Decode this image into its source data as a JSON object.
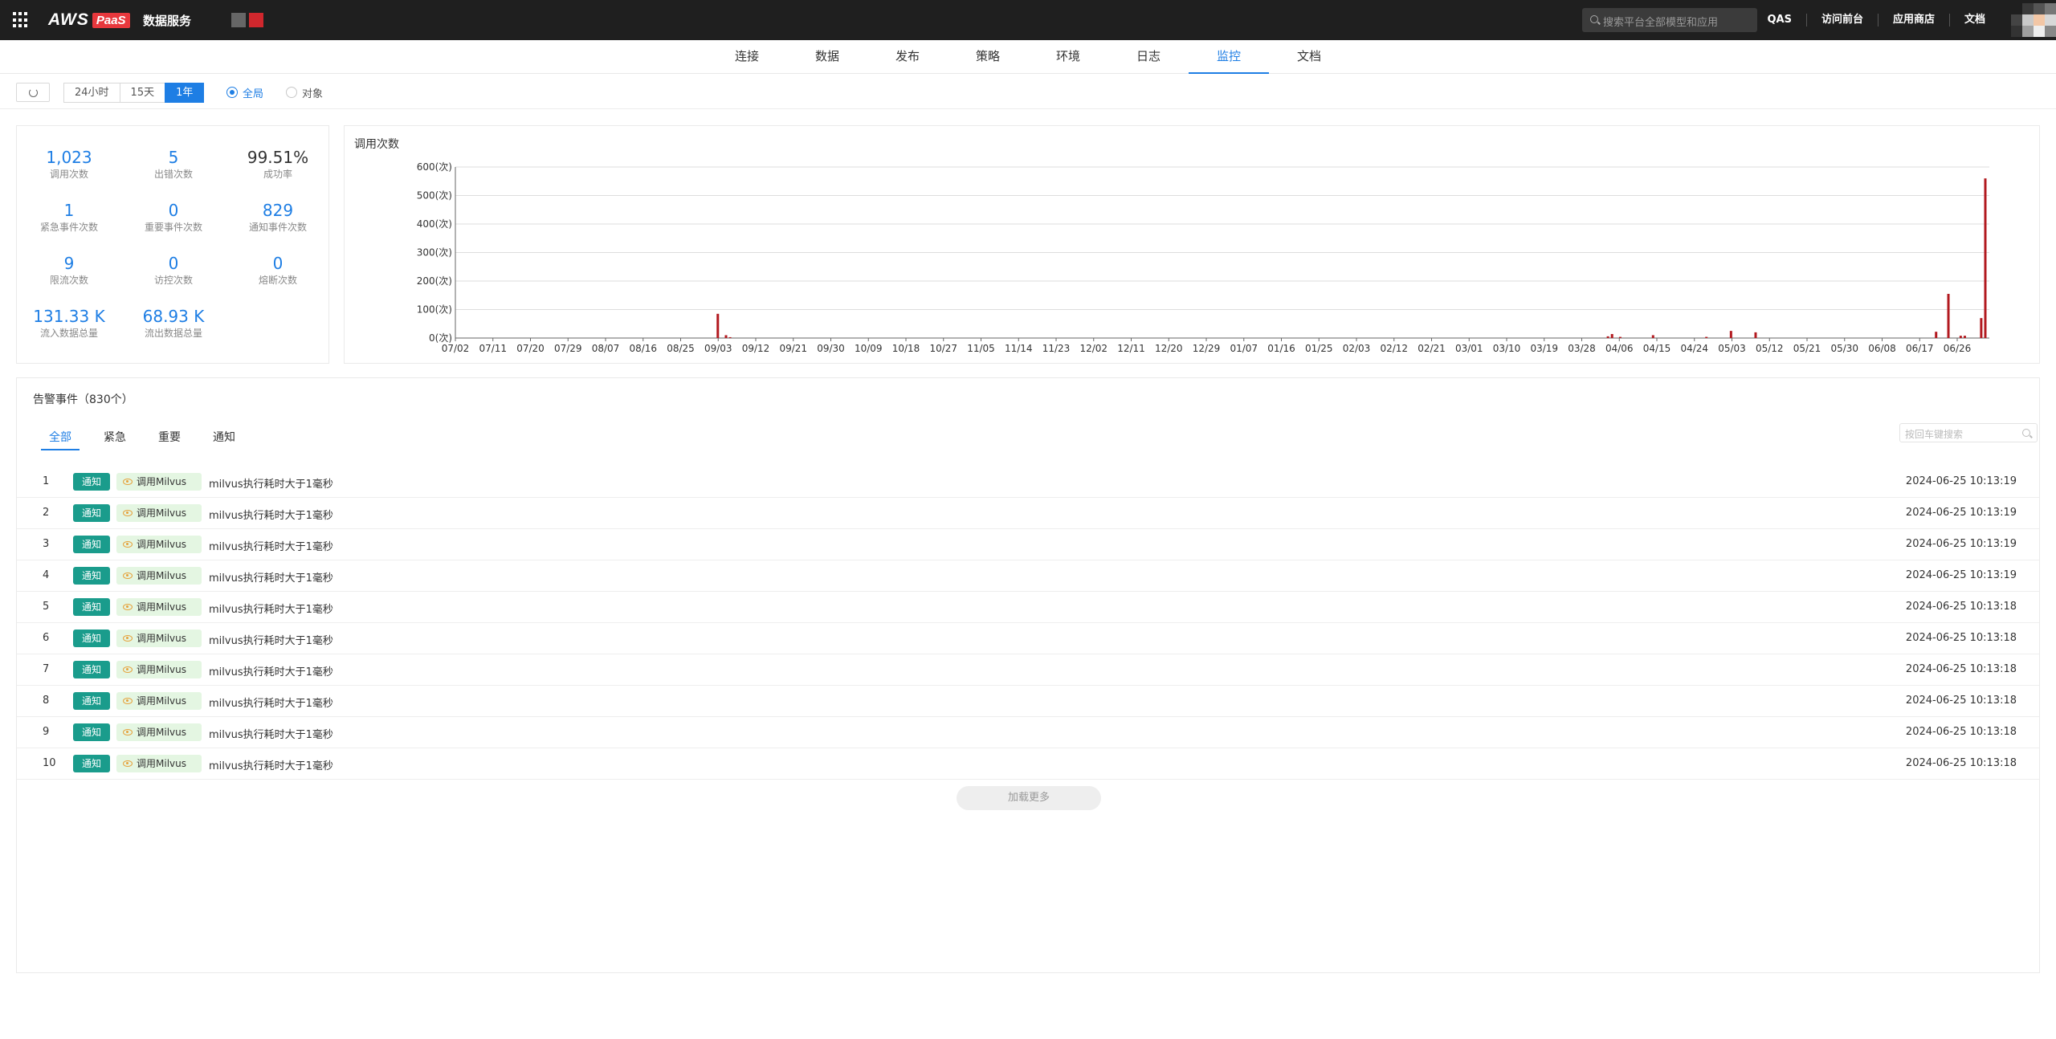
{
  "header": {
    "logo_aws": "AWS",
    "logo_paas": "PaaS",
    "app_name": "数据服务",
    "search_placeholder": "搜索平台全部模型和应用",
    "links": [
      "QAS",
      "访问前台",
      "应用商店",
      "文档"
    ]
  },
  "nav": {
    "tabs": [
      "连接",
      "数据",
      "发布",
      "策略",
      "环境",
      "日志",
      "监控",
      "文档"
    ],
    "active": "监控"
  },
  "toolbar": {
    "ranges": [
      "24小时",
      "15天",
      "1年"
    ],
    "active_range": "1年",
    "scope": [
      "全局",
      "对象"
    ],
    "active_scope": "全局"
  },
  "stats": [
    {
      "value": "1,023",
      "label": "调用次数"
    },
    {
      "value": "5",
      "label": "出错次数"
    },
    {
      "value": "99.51%",
      "label": "成功率"
    },
    {
      "value": "1",
      "label": "紧急事件次数"
    },
    {
      "value": "0",
      "label": "重要事件次数"
    },
    {
      "value": "829",
      "label": "通知事件次数"
    },
    {
      "value": "9",
      "label": "限流次数"
    },
    {
      "value": "0",
      "label": "访控次数"
    },
    {
      "value": "0",
      "label": "熔断次数"
    },
    {
      "value": "131.33 K",
      "label": "流入数据总量"
    },
    {
      "value": "68.93 K",
      "label": "流出数据总量"
    }
  ],
  "chart_data": {
    "type": "bar",
    "title": "调用次数",
    "y_ticks": [
      "0(次)",
      "100(次)",
      "200(次)",
      "300(次)",
      "400(次)",
      "500(次)",
      "600(次)"
    ],
    "ylim": [
      0,
      600
    ],
    "x_ticks": [
      "07/02",
      "07/11",
      "07/20",
      "07/29",
      "08/07",
      "08/16",
      "08/25",
      "09/03",
      "09/12",
      "09/21",
      "09/30",
      "10/09",
      "10/18",
      "10/27",
      "11/05",
      "11/14",
      "11/23",
      "12/02",
      "12/11",
      "12/20",
      "12/29",
      "01/07",
      "01/16",
      "01/25",
      "02/03",
      "02/12",
      "02/21",
      "03/01",
      "03/10",
      "03/19",
      "03/28",
      "04/06",
      "04/15",
      "04/24",
      "05/03",
      "05/12",
      "05/21",
      "05/30",
      "06/08",
      "06/17",
      "06/26"
    ],
    "color": "#b2191f",
    "grid": true,
    "bars": [
      {
        "day": 63,
        "value": 85
      },
      {
        "day": 65,
        "value": 10
      },
      {
        "day": 66,
        "value": 3
      },
      {
        "day": 280,
        "value": 6
      },
      {
        "day": 281,
        "value": 14
      },
      {
        "day": 283,
        "value": 4
      },
      {
        "day": 291,
        "value": 10
      },
      {
        "day": 304,
        "value": 4
      },
      {
        "day": 310,
        "value": 25
      },
      {
        "day": 316,
        "value": 20
      },
      {
        "day": 360,
        "value": 22
      },
      {
        "day": 363,
        "value": 155
      },
      {
        "day": 366,
        "value": 8
      },
      {
        "day": 367,
        "value": 8
      },
      {
        "day": 371,
        "value": 70
      },
      {
        "day": 372,
        "value": 560
      }
    ]
  },
  "alerts": {
    "title": "告警事件（830个）",
    "tabs": [
      "全部",
      "紧急",
      "重要",
      "通知"
    ],
    "active_tab": "全部",
    "search_placeholder": "按回车键搜索",
    "load_more": "加载更多",
    "rows": [
      {
        "index": "1",
        "level": "通知",
        "source": "调用Milvus",
        "message": "milvus执行耗时大于1毫秒",
        "time": "2024-06-25 10:13:19"
      },
      {
        "index": "2",
        "level": "通知",
        "source": "调用Milvus",
        "message": "milvus执行耗时大于1毫秒",
        "time": "2024-06-25 10:13:19"
      },
      {
        "index": "3",
        "level": "通知",
        "source": "调用Milvus",
        "message": "milvus执行耗时大于1毫秒",
        "time": "2024-06-25 10:13:19"
      },
      {
        "index": "4",
        "level": "通知",
        "source": "调用Milvus",
        "message": "milvus执行耗时大于1毫秒",
        "time": "2024-06-25 10:13:19"
      },
      {
        "index": "5",
        "level": "通知",
        "source": "调用Milvus",
        "message": "milvus执行耗时大于1毫秒",
        "time": "2024-06-25 10:13:18"
      },
      {
        "index": "6",
        "level": "通知",
        "source": "调用Milvus",
        "message": "milvus执行耗时大于1毫秒",
        "time": "2024-06-25 10:13:18"
      },
      {
        "index": "7",
        "level": "通知",
        "source": "调用Milvus",
        "message": "milvus执行耗时大于1毫秒",
        "time": "2024-06-25 10:13:18"
      },
      {
        "index": "8",
        "level": "通知",
        "source": "调用Milvus",
        "message": "milvus执行耗时大于1毫秒",
        "time": "2024-06-25 10:13:18"
      },
      {
        "index": "9",
        "level": "通知",
        "source": "调用Milvus",
        "message": "milvus执行耗时大于1毫秒",
        "time": "2024-06-25 10:13:18"
      },
      {
        "index": "10",
        "level": "通知",
        "source": "调用Milvus",
        "message": "milvus执行耗时大于1毫秒",
        "time": "2024-06-25 10:13:18"
      }
    ]
  }
}
